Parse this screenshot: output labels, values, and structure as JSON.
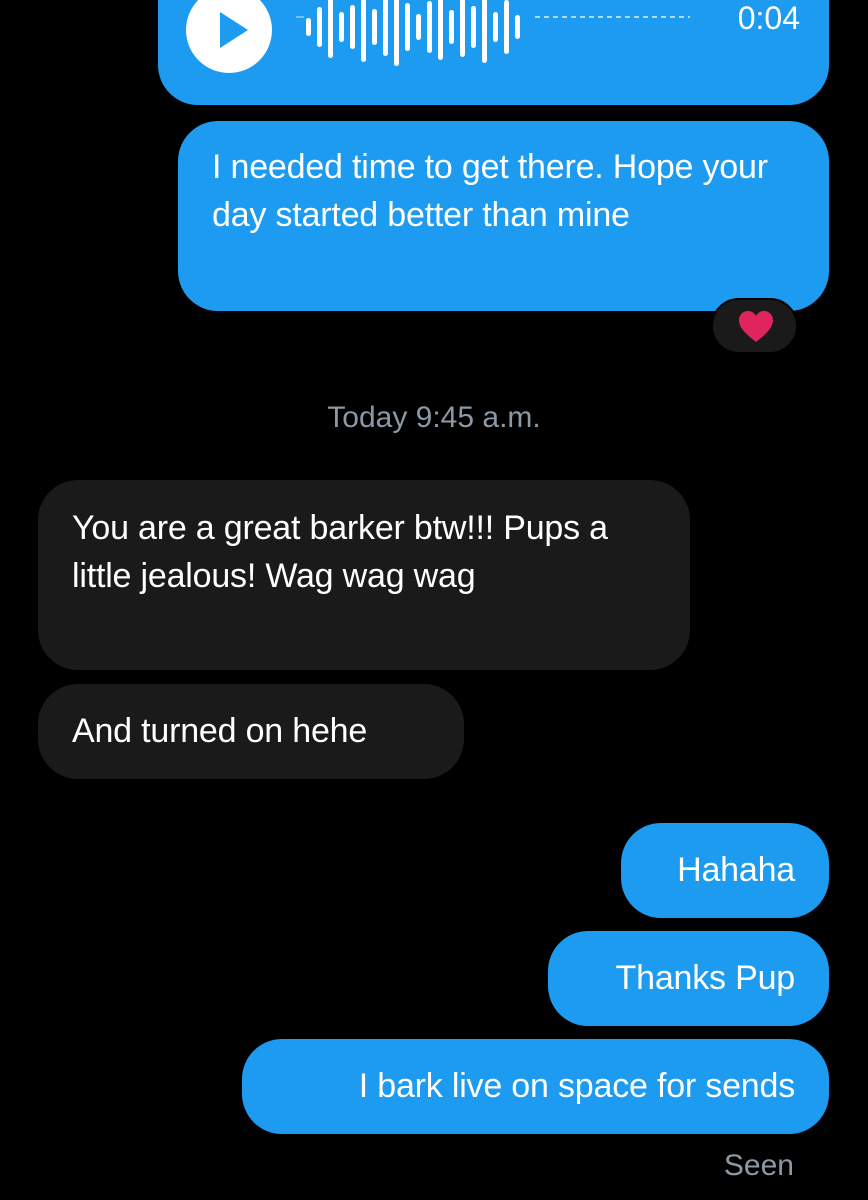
{
  "voice_message": {
    "duration": "0:04",
    "icon": "play-icon"
  },
  "messages": [
    {
      "direction": "outgoing",
      "text": "I needed time to get there. Hope your day started better than mine"
    },
    {
      "direction": "incoming",
      "text": "You are a great barker btw!!! Pups a little jealous!  Wag wag wag"
    },
    {
      "direction": "incoming",
      "text": "And turned on hehe"
    },
    {
      "direction": "outgoing",
      "text": "Hahaha"
    },
    {
      "direction": "outgoing",
      "text": "Thanks Pup"
    },
    {
      "direction": "outgoing",
      "text": "I bark live on space for sends"
    }
  ],
  "reaction": {
    "icon": "heart-icon",
    "color": "#e0245e"
  },
  "timestamp": "Today 9:45 a.m.",
  "status": "Seen",
  "colors": {
    "outgoing_bubble": "#1d9bf0",
    "incoming_bubble": "#1a1a1a",
    "background": "#000000",
    "secondary_text": "#8b98a5"
  }
}
